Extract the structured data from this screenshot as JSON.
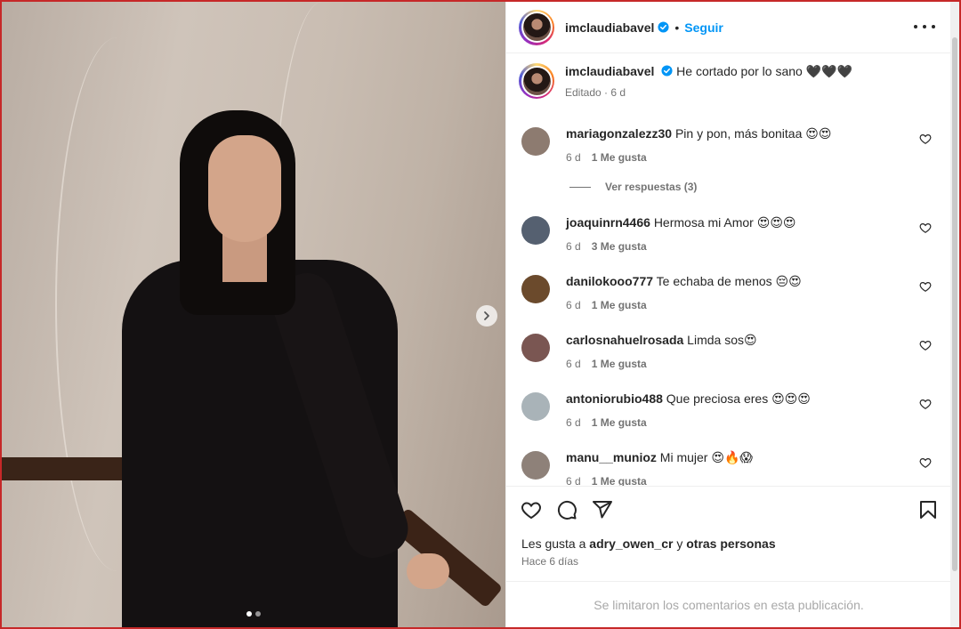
{
  "post": {
    "username": "imclaudiabavel",
    "separator": "•",
    "follow_label": "Seguir",
    "caption": "He cortado por lo sano 🖤🖤🖤",
    "caption_meta": "Editado · 6 d",
    "carousel": {
      "count": 2,
      "active_index": 0
    }
  },
  "comments": [
    {
      "user": "mariagonzalezz30",
      "text": "Pin y pon, más bonitaa 😍😍",
      "age": "6 d",
      "likes": "1 Me gusta",
      "avatar_color": "#8d7b70"
    },
    {
      "user": "joaquinrn4466",
      "text": "Hermosa mi Amor 😍😍😍",
      "age": "6 d",
      "likes": "3 Me gusta",
      "avatar_color": "#556070"
    },
    {
      "user": "danilokooo777",
      "text": "Te echaba de menos 😔😍",
      "age": "6 d",
      "likes": "1 Me gusta",
      "avatar_color": "#6b4a2c"
    },
    {
      "user": "carlosnahuelrosada",
      "text": "Limda sos😍",
      "age": "6 d",
      "likes": "1 Me gusta",
      "avatar_color": "#7a5652"
    },
    {
      "user": "antoniorubio488",
      "text": "Que preciosa eres 😍😍😍",
      "age": "6 d",
      "likes": "1 Me gusta",
      "avatar_color": "#a9b3b8"
    },
    {
      "user": "manu__munioz",
      "text": "Mi mujer 😍🔥😱",
      "age": "6 d",
      "likes": "1 Me gusta",
      "avatar_color": "#8e8179"
    }
  ],
  "replies_label": "Ver respuestas (3)",
  "likes_prefix": "Les gusta a",
  "likes_user": "adry_owen_cr",
  "likes_join": "y",
  "likes_rest": "otras personas",
  "post_time": "Hace 6 días",
  "comments_limited": "Se limitaron los comentarios en esta publicación.",
  "colors": {
    "accent": "#0095f6",
    "verified": "#0095f6",
    "muted": "#737373",
    "frame": "#c62828"
  },
  "icons": [
    "chevron-right-icon",
    "verified-icon",
    "more-icon",
    "heart-icon",
    "comment-icon",
    "share-icon",
    "save-icon"
  ]
}
